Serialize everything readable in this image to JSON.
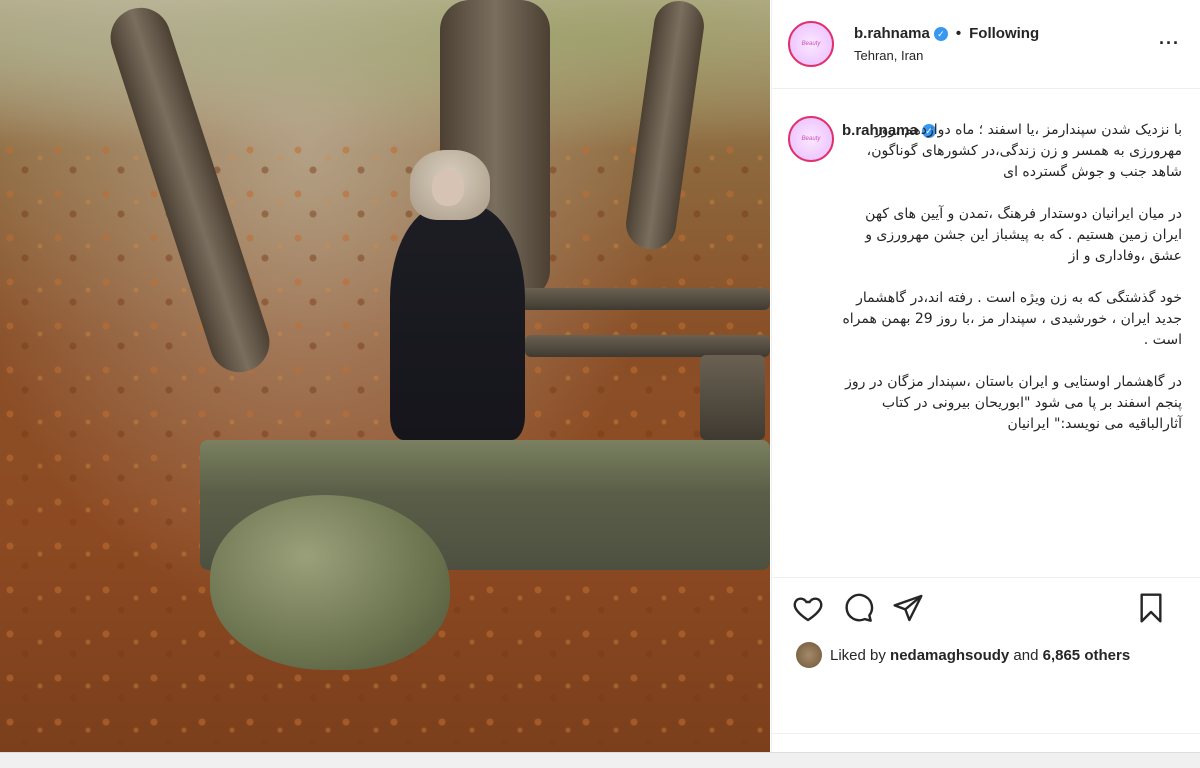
{
  "post": {
    "username": "b.rahnama",
    "verified_glyph": "✓",
    "separator": "•",
    "follow_status": "Following",
    "location": "Tehran, Iran",
    "more_glyph": "···",
    "avatar_text": "Beauty",
    "caption_paragraphs": [
      "با نزدیک شدن سپندارمز ،یا اسفند ؛ ماه دوازدهم ،روز مهرورزی به همسر و زن زندگی،در کشورهای گوناگون، شاهد جنب و جوش گسترده ای",
      "در میان ایرانیان دوستدار فرهنگ ،تمدن و آیین های کهن ایران زمین هستیم . که به پیشباز این جشن مهرورزی و عشق ،وفاداری و از",
      "خود گذشتگی که به زن ویژه است . رفته اند،در گاهشمار جدید ایران ، خورشیدی ، سپندار مز ،با روز 29 بهمن همراه است .",
      "در گاهشمار اوستایی و ایران باستان ،سپندار مزگان در روز پنجم اسفند بر پا می شود \"ابوریحان بیرونی در کتاب آثارالباقیه می نویسد:\" ایرانیان"
    ],
    "likes": {
      "prefix": "Liked by",
      "user": "nedamaghsoudy",
      "middle": "and",
      "others": "6,865 others"
    }
  },
  "icons": [
    "heart-icon",
    "comment-icon",
    "share-icon",
    "bookmark-icon"
  ]
}
